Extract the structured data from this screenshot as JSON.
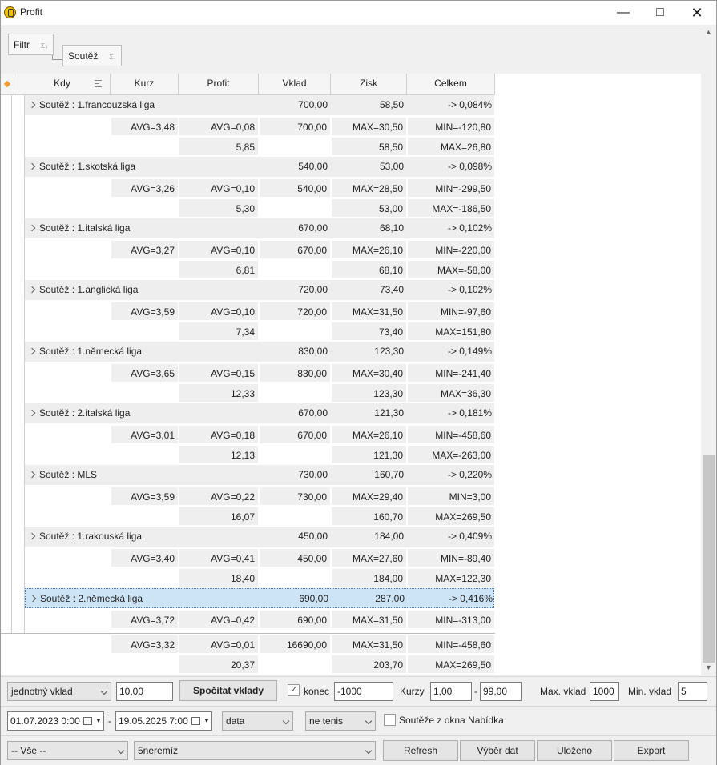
{
  "window": {
    "title": "Profit"
  },
  "groupbar": {
    "chip1": "Filtr",
    "chip2": "Soutěž",
    "sum_glyph": "Σ↓"
  },
  "columns": [
    "Kdy",
    "Kurz",
    "Profit",
    "Vklad",
    "Zisk",
    "Celkem"
  ],
  "groups": [
    {
      "label": "Soutěž : 1.francouzská liga",
      "vklad": "700,00",
      "zisk": "58,50",
      "celkem": "-> 0,084%",
      "r1": {
        "kurz": "AVG=3,48",
        "profit": "AVG=0,08",
        "vklad": "700,00",
        "zisk": "MAX=30,50",
        "celkem": "MIN=-120,80"
      },
      "r2": {
        "profit": "5,85",
        "zisk": "58,50",
        "celkem": "MAX=26,80"
      }
    },
    {
      "label": "Soutěž : 1.skotská liga",
      "vklad": "540,00",
      "zisk": "53,00",
      "celkem": "-> 0,098%",
      "r1": {
        "kurz": "AVG=3,26",
        "profit": "AVG=0,10",
        "vklad": "540,00",
        "zisk": "MAX=28,50",
        "celkem": "MIN=-299,50"
      },
      "r2": {
        "profit": "5,30",
        "zisk": "53,00",
        "celkem": "MAX=-186,50"
      }
    },
    {
      "label": "Soutěž : 1.italská liga",
      "vklad": "670,00",
      "zisk": "68,10",
      "celkem": "-> 0,102%",
      "r1": {
        "kurz": "AVG=3,27",
        "profit": "AVG=0,10",
        "vklad": "670,00",
        "zisk": "MAX=26,10",
        "celkem": "MIN=-220,00"
      },
      "r2": {
        "profit": "6,81",
        "zisk": "68,10",
        "celkem": "MAX=-58,00"
      }
    },
    {
      "label": "Soutěž : 1.anglická liga",
      "vklad": "720,00",
      "zisk": "73,40",
      "celkem": "-> 0,102%",
      "r1": {
        "kurz": "AVG=3,59",
        "profit": "AVG=0,10",
        "vklad": "720,00",
        "zisk": "MAX=31,50",
        "celkem": "MIN=-97,60"
      },
      "r2": {
        "profit": "7,34",
        "zisk": "73,40",
        "celkem": "MAX=151,80"
      }
    },
    {
      "label": "Soutěž : 1.německá liga",
      "vklad": "830,00",
      "zisk": "123,30",
      "celkem": "-> 0,149%",
      "r1": {
        "kurz": "AVG=3,65",
        "profit": "AVG=0,15",
        "vklad": "830,00",
        "zisk": "MAX=30,40",
        "celkem": "MIN=-241,40"
      },
      "r2": {
        "profit": "12,33",
        "zisk": "123,30",
        "celkem": "MAX=36,30"
      }
    },
    {
      "label": "Soutěž : 2.italská liga",
      "vklad": "670,00",
      "zisk": "121,30",
      "celkem": "-> 0,181%",
      "r1": {
        "kurz": "AVG=3,01",
        "profit": "AVG=0,18",
        "vklad": "670,00",
        "zisk": "MAX=26,10",
        "celkem": "MIN=-458,60"
      },
      "r2": {
        "profit": "12,13",
        "zisk": "121,30",
        "celkem": "MAX=-263,00"
      }
    },
    {
      "label": "Soutěž : MLS",
      "vklad": "730,00",
      "zisk": "160,70",
      "celkem": "-> 0,220%",
      "r1": {
        "kurz": "AVG=3,59",
        "profit": "AVG=0,22",
        "vklad": "730,00",
        "zisk": "MAX=29,40",
        "celkem": "MIN=3,00"
      },
      "r2": {
        "profit": "16,07",
        "zisk": "160,70",
        "celkem": "MAX=269,50"
      }
    },
    {
      "label": "Soutěž : 1.rakouská liga",
      "vklad": "450,00",
      "zisk": "184,00",
      "celkem": "-> 0,409%",
      "r1": {
        "kurz": "AVG=3,40",
        "profit": "AVG=0,41",
        "vklad": "450,00",
        "zisk": "MAX=27,60",
        "celkem": "MIN=-89,40"
      },
      "r2": {
        "profit": "18,40",
        "zisk": "184,00",
        "celkem": "MAX=122,30"
      }
    },
    {
      "label": "Soutěž : 2.německá liga",
      "vklad": "690,00",
      "zisk": "287,00",
      "celkem": "-> 0,416%",
      "r1": {
        "kurz": "AVG=3,72",
        "profit": "AVG=0,42",
        "vklad": "690,00",
        "zisk": "MAX=31,50",
        "celkem": "MIN=-313,00"
      },
      "r2": null
    }
  ],
  "totals": {
    "r1": {
      "kurz": "AVG=3,32",
      "profit": "AVG=0,01",
      "vklad": "16690,00",
      "zisk": "MAX=31,50",
      "celkem": "MIN=-458,60"
    },
    "r2": {
      "profit": "20,37",
      "zisk": "203,70",
      "celkem": "MAX=269,50"
    }
  },
  "bottom1": {
    "stake_type": "jednotný vklad",
    "stake_value": "10,00",
    "calc_button": "Spočítat vklady",
    "konec_label": "konec",
    "konec_value": "-1000",
    "kurzy_label": "Kurzy",
    "kurzy_from": "1,00",
    "dash": "-",
    "kurzy_to": "99,00",
    "max_label": "Max. vklad",
    "max_value": "1000",
    "min_label": "Min. vklad",
    "min_value": "5"
  },
  "bottom2": {
    "date_from": "01.07.2023  0:00",
    "dash": "-",
    "date_to": "19.05.2025  7:00",
    "data_select": "data",
    "sport_select": "ne tenis",
    "nabidka_label": "Soutěže z okna Nabídka"
  },
  "bottom3": {
    "filter1": "-- Vše --",
    "filter2": "5neremíz",
    "refresh": "Refresh",
    "vyber": "Výběr dat",
    "ulozeno": "Uloženo",
    "export": "Export"
  }
}
